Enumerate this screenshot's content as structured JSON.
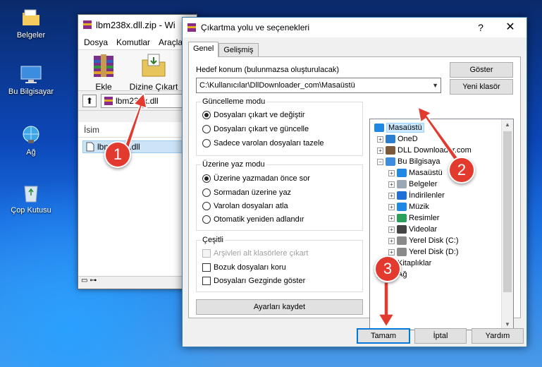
{
  "desktop": {
    "icons": [
      {
        "label": "Belgeler",
        "icon": "folder-icon"
      },
      {
        "label": "Bu Bilgisayar",
        "icon": "computer-icon"
      },
      {
        "label": "Ağ",
        "icon": "network-icon"
      },
      {
        "label": "Çop Kutusu",
        "icon": "recycle-bin-icon"
      }
    ]
  },
  "winrar": {
    "title": "lbm238x.dll.zip - Wi",
    "menu": [
      "Dosya",
      "Komutlar",
      "Araçla"
    ],
    "tools": [
      {
        "label": "Ekle",
        "icon": "add-archive-icon"
      },
      {
        "label": "Dizine Çıkart",
        "icon": "extract-to-icon"
      }
    ],
    "path_value": "lbm238x.dll",
    "column_name": "İsim",
    "file_name": "lbm238x.dll"
  },
  "dialog": {
    "title": "Çıkartma yolu ve seçenekleri",
    "help": "?",
    "close": "✕",
    "tabs": [
      "Genel",
      "Gelişmiş"
    ],
    "target_label": "Hedef konum (bulunmazsa oluşturulacak)",
    "target_value": "C:\\Kullanıcılar\\DllDownloader_com\\Masaüstü",
    "show_button": "Göster",
    "new_folder_button": "Yeni klasör",
    "update_mode": {
      "title": "Güncelleme modu",
      "options": [
        "Dosyaları çıkart ve değiştir",
        "Dosyaları çıkart ve güncelle",
        "Sadece varolan dosyaları tazele"
      ],
      "selected": 0
    },
    "overwrite_mode": {
      "title": "Üzerine yaz modu",
      "options": [
        "Üzerine yazmadan önce sor",
        "Sormadan üzerine yaz",
        "Varolan dosyaları atla",
        "Otomatik yeniden adlandır"
      ],
      "selected": 0
    },
    "misc": {
      "title": "Çeşitli",
      "options": [
        "Arşivleri alt klasörlere çıkart",
        "Bozuk dosyaları koru",
        "Dosyaları Gezginde göster"
      ]
    },
    "save_settings_button": "Ayarları kaydet",
    "tree": [
      {
        "label": "Masaüstü",
        "level": 0,
        "icon": "desktop-icon",
        "expander": "",
        "selected": true
      },
      {
        "label": "OneD",
        "level": 1,
        "icon": "onedrive-icon",
        "expander": "+"
      },
      {
        "label": "DLL Downloader.com",
        "level": 1,
        "icon": "user-icon",
        "expander": "+"
      },
      {
        "label": "Bu Bilgisaya",
        "level": 1,
        "icon": "computer-icon",
        "expander": "−"
      },
      {
        "label": "Masaüstü",
        "level": 2,
        "icon": "desktop-icon",
        "expander": "+"
      },
      {
        "label": "Belgeler",
        "level": 2,
        "icon": "documents-icon",
        "expander": "+"
      },
      {
        "label": "İndirilenler",
        "level": 2,
        "icon": "downloads-icon",
        "expander": "+"
      },
      {
        "label": "Müzik",
        "level": 2,
        "icon": "music-icon",
        "expander": "+"
      },
      {
        "label": "Resimler",
        "level": 2,
        "icon": "pictures-icon",
        "expander": "+"
      },
      {
        "label": "Videolar",
        "level": 2,
        "icon": "videos-icon",
        "expander": "+"
      },
      {
        "label": "Yerel Disk (C:)",
        "level": 2,
        "icon": "disk-icon",
        "expander": "+"
      },
      {
        "label": "Yerel Disk (D:)",
        "level": 2,
        "icon": "disk-icon",
        "expander": "+"
      },
      {
        "label": "Kitaplıklar",
        "level": 1,
        "icon": "libraries-icon",
        "expander": "+"
      },
      {
        "label": "Ağ",
        "level": 1,
        "icon": "network-icon",
        "expander": "+"
      }
    ],
    "ok_button": "Tamam",
    "cancel_button": "İptal",
    "help_button": "Yardım"
  },
  "callouts": [
    "1",
    "2",
    "3"
  ],
  "colors": {
    "callout": "#e33a2f",
    "selection": "#cce8ff",
    "accent": "#0078d7"
  }
}
